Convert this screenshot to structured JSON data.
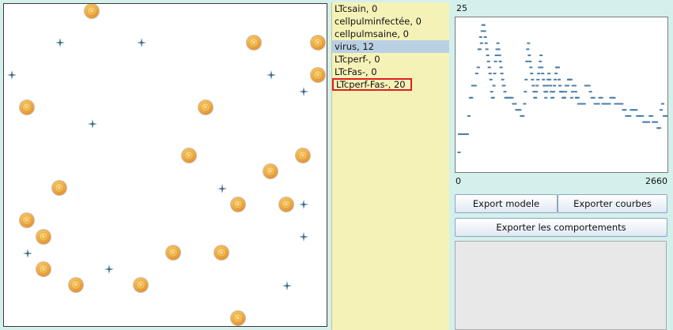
{
  "species_list": [
    {
      "label": "LTcsain, 0",
      "state": "normal"
    },
    {
      "label": "cellpulminfectée, 0",
      "state": "normal"
    },
    {
      "label": "cellpulmsaine, 0",
      "state": "normal"
    },
    {
      "label": "virus, 12",
      "state": "selected"
    },
    {
      "label": "LTcperf-, 0",
      "state": "normal"
    },
    {
      "label": "LTcFas-, 0",
      "state": "normal"
    },
    {
      "label": "LTcperf-Fas-, 20",
      "state": "highlighted"
    }
  ],
  "chart": {
    "y_max_label": "25",
    "x_min_label": "0",
    "x_max_label": "2660"
  },
  "chart_data": {
    "type": "scatter",
    "xlim": [
      0,
      2660
    ],
    "ylim": [
      0,
      25
    ],
    "series": [
      {
        "color": "#4a7fa8",
        "points": [
          [
            25,
            3
          ],
          [
            30,
            6
          ],
          [
            50,
            6
          ],
          [
            80,
            6
          ],
          [
            110,
            6
          ],
          [
            130,
            6
          ],
          [
            150,
            9
          ],
          [
            170,
            12
          ],
          [
            185,
            12
          ],
          [
            200,
            14
          ],
          [
            215,
            14
          ],
          [
            230,
            14
          ],
          [
            250,
            16
          ],
          [
            270,
            17
          ],
          [
            280,
            20
          ],
          [
            290,
            20
          ],
          [
            300,
            22
          ],
          [
            310,
            21
          ],
          [
            320,
            23
          ],
          [
            330,
            24
          ],
          [
            340,
            24
          ],
          [
            350,
            23
          ],
          [
            360,
            22
          ],
          [
            370,
            21
          ],
          [
            380,
            20
          ],
          [
            390,
            19
          ],
          [
            400,
            18
          ],
          [
            410,
            17
          ],
          [
            420,
            16
          ],
          [
            430,
            15
          ],
          [
            440,
            13
          ],
          [
            450,
            12
          ],
          [
            460,
            12
          ],
          [
            470,
            14
          ],
          [
            480,
            16
          ],
          [
            490,
            18
          ],
          [
            500,
            19
          ],
          [
            510,
            20
          ],
          [
            520,
            21
          ],
          [
            530,
            20
          ],
          [
            540,
            19
          ],
          [
            550,
            18
          ],
          [
            560,
            17
          ],
          [
            570,
            16
          ],
          [
            580,
            15
          ],
          [
            590,
            14
          ],
          [
            600,
            14
          ],
          [
            610,
            13
          ],
          [
            620,
            12
          ],
          [
            640,
            12
          ],
          [
            660,
            12
          ],
          [
            680,
            12
          ],
          [
            700,
            12
          ],
          [
            720,
            11
          ],
          [
            740,
            11
          ],
          [
            760,
            10
          ],
          [
            780,
            10
          ],
          [
            800,
            10
          ],
          [
            820,
            9
          ],
          [
            840,
            9
          ],
          [
            860,
            11
          ],
          [
            870,
            13
          ],
          [
            880,
            15
          ],
          [
            890,
            18
          ],
          [
            900,
            20
          ],
          [
            910,
            21
          ],
          [
            920,
            19
          ],
          [
            930,
            18
          ],
          [
            940,
            17
          ],
          [
            950,
            16
          ],
          [
            960,
            15
          ],
          [
            970,
            14
          ],
          [
            980,
            13
          ],
          [
            990,
            12
          ],
          [
            1000,
            12
          ],
          [
            1010,
            13
          ],
          [
            1020,
            14
          ],
          [
            1030,
            15
          ],
          [
            1040,
            16
          ],
          [
            1050,
            17
          ],
          [
            1060,
            18
          ],
          [
            1070,
            19
          ],
          [
            1080,
            17
          ],
          [
            1090,
            16
          ],
          [
            1100,
            15
          ],
          [
            1110,
            14
          ],
          [
            1120,
            13
          ],
          [
            1130,
            12
          ],
          [
            1140,
            13
          ],
          [
            1150,
            14
          ],
          [
            1160,
            15
          ],
          [
            1170,
            16
          ],
          [
            1180,
            15
          ],
          [
            1190,
            14
          ],
          [
            1200,
            13
          ],
          [
            1210,
            12
          ],
          [
            1220,
            12
          ],
          [
            1230,
            13
          ],
          [
            1240,
            14
          ],
          [
            1250,
            15
          ],
          [
            1260,
            16
          ],
          [
            1270,
            17
          ],
          [
            1280,
            17
          ],
          [
            1290,
            17
          ],
          [
            1300,
            15
          ],
          [
            1310,
            14
          ],
          [
            1320,
            13
          ],
          [
            1330,
            13
          ],
          [
            1340,
            13
          ],
          [
            1350,
            12
          ],
          [
            1360,
            12
          ],
          [
            1370,
            12
          ],
          [
            1380,
            13
          ],
          [
            1390,
            14
          ],
          [
            1400,
            14
          ],
          [
            1410,
            14
          ],
          [
            1420,
            15
          ],
          [
            1430,
            15
          ],
          [
            1440,
            15
          ],
          [
            1450,
            15
          ],
          [
            1460,
            12
          ],
          [
            1470,
            13
          ],
          [
            1480,
            14
          ],
          [
            1490,
            14
          ],
          [
            1500,
            14
          ],
          [
            1510,
            13
          ],
          [
            1520,
            12
          ],
          [
            1530,
            12
          ],
          [
            1540,
            12
          ],
          [
            1550,
            11
          ],
          [
            1560,
            11
          ],
          [
            1570,
            11
          ],
          [
            1580,
            11
          ],
          [
            1590,
            11
          ],
          [
            1600,
            11
          ],
          [
            1620,
            11
          ],
          [
            1640,
            14
          ],
          [
            1660,
            14
          ],
          [
            1680,
            14
          ],
          [
            1700,
            13
          ],
          [
            1720,
            12
          ],
          [
            1740,
            12
          ],
          [
            1760,
            11
          ],
          [
            1780,
            11
          ],
          [
            1800,
            11
          ],
          [
            1820,
            12
          ],
          [
            1840,
            12
          ],
          [
            1860,
            11
          ],
          [
            1880,
            11
          ],
          [
            1900,
            11
          ],
          [
            1920,
            11
          ],
          [
            1940,
            11
          ],
          [
            1960,
            12
          ],
          [
            1980,
            12
          ],
          [
            2000,
            12
          ],
          [
            2020,
            11
          ],
          [
            2040,
            11
          ],
          [
            2060,
            11
          ],
          [
            2080,
            11
          ],
          [
            2100,
            11
          ],
          [
            2120,
            10
          ],
          [
            2140,
            10
          ],
          [
            2160,
            9
          ],
          [
            2180,
            9
          ],
          [
            2200,
            9
          ],
          [
            2220,
            10
          ],
          [
            2240,
            10
          ],
          [
            2260,
            10
          ],
          [
            2280,
            10
          ],
          [
            2300,
            9
          ],
          [
            2320,
            9
          ],
          [
            2340,
            9
          ],
          [
            2360,
            9
          ],
          [
            2380,
            8
          ],
          [
            2400,
            8
          ],
          [
            2420,
            8
          ],
          [
            2440,
            8
          ],
          [
            2460,
            9
          ],
          [
            2480,
            9
          ],
          [
            2500,
            8
          ],
          [
            2520,
            8
          ],
          [
            2540,
            8
          ],
          [
            2560,
            7
          ],
          [
            2580,
            7
          ],
          [
            2600,
            10
          ],
          [
            2620,
            11
          ],
          [
            2640,
            9
          ],
          [
            2660,
            9
          ]
        ]
      }
    ]
  },
  "buttons": {
    "export_model": "Export modele",
    "export_curves": "Exporter courbes",
    "export_behaviors": "Exporter les comportements"
  },
  "simulation": {
    "cell_color": "#f0b040",
    "virus_color": "#3f6e8e",
    "cells": [
      {
        "kind": "healthy-lung-cell"
      }
    ]
  }
}
